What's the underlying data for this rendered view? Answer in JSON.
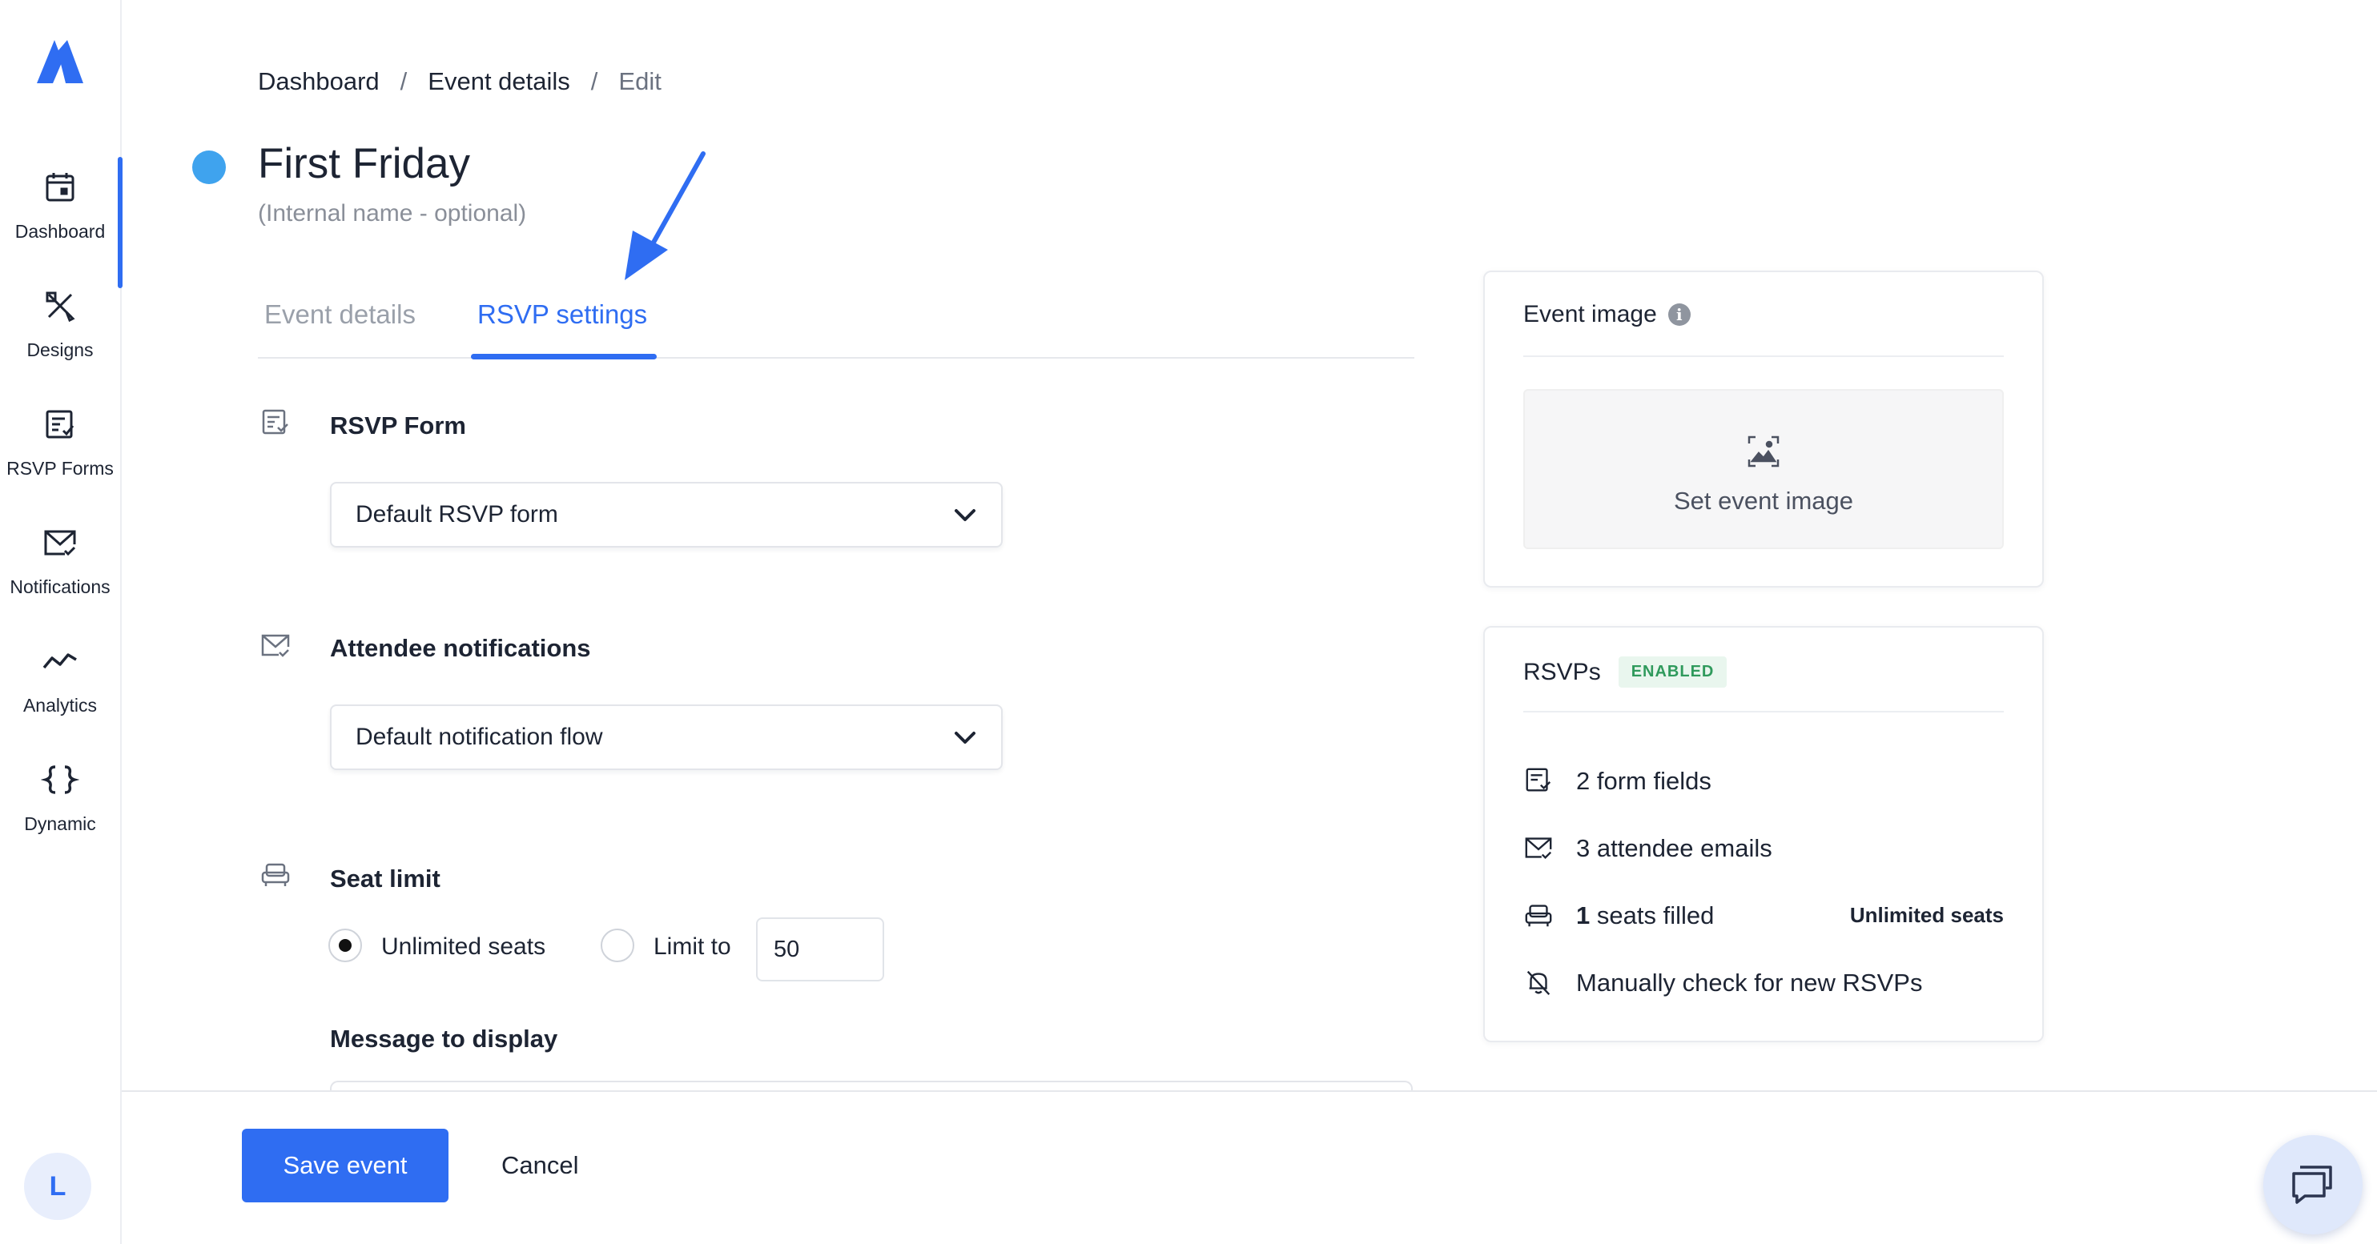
{
  "sidebar": {
    "items": [
      {
        "label": "Dashboard",
        "icon": "calendar-icon"
      },
      {
        "label": "Designs",
        "icon": "designs-icon"
      },
      {
        "label": "RSVP Forms",
        "icon": "form-icon"
      },
      {
        "label": "Notifications",
        "icon": "mail-check-icon"
      },
      {
        "label": "Analytics",
        "icon": "analytics-icon"
      },
      {
        "label": "Dynamic",
        "icon": "braces-icon"
      }
    ],
    "avatar": "L"
  },
  "breadcrumb": {
    "items": [
      "Dashboard",
      "Event details",
      "Edit"
    ],
    "separator": "/"
  },
  "event": {
    "title": "First Friday",
    "subtitle": "(Internal name - optional)",
    "dot_color": "#3fa3ee"
  },
  "tabs": [
    {
      "label": "Event details",
      "active": false
    },
    {
      "label": "RSVP settings",
      "active": true
    }
  ],
  "rsvp_form": {
    "title": "RSVP Form",
    "selected": "Default RSVP form"
  },
  "attendee_notifications": {
    "title": "Attendee notifications",
    "selected": "Default notification flow"
  },
  "seat_limit": {
    "title": "Seat limit",
    "options": [
      "Unlimited seats",
      "Limit to"
    ],
    "selected": "Unlimited seats",
    "limit_value": "50"
  },
  "message": {
    "title": "Message to display"
  },
  "event_image_card": {
    "title": "Event image",
    "button_label": "Set event image"
  },
  "rsvps_card": {
    "title": "RSVPs",
    "badge": "ENABLED",
    "form_fields": "2 form fields",
    "attendee_emails": "3 attendee emails",
    "seats_count": "1",
    "seats_filled": "seats filled",
    "seats_right": "Unlimited seats",
    "check": "Manually check for new RSVPs"
  },
  "footer": {
    "save_label": "Save event",
    "cancel_label": "Cancel"
  },
  "colors": {
    "accent": "#2f6df2",
    "badge_bg": "#e9f6ee",
    "badge_text": "#2f9a5c"
  }
}
